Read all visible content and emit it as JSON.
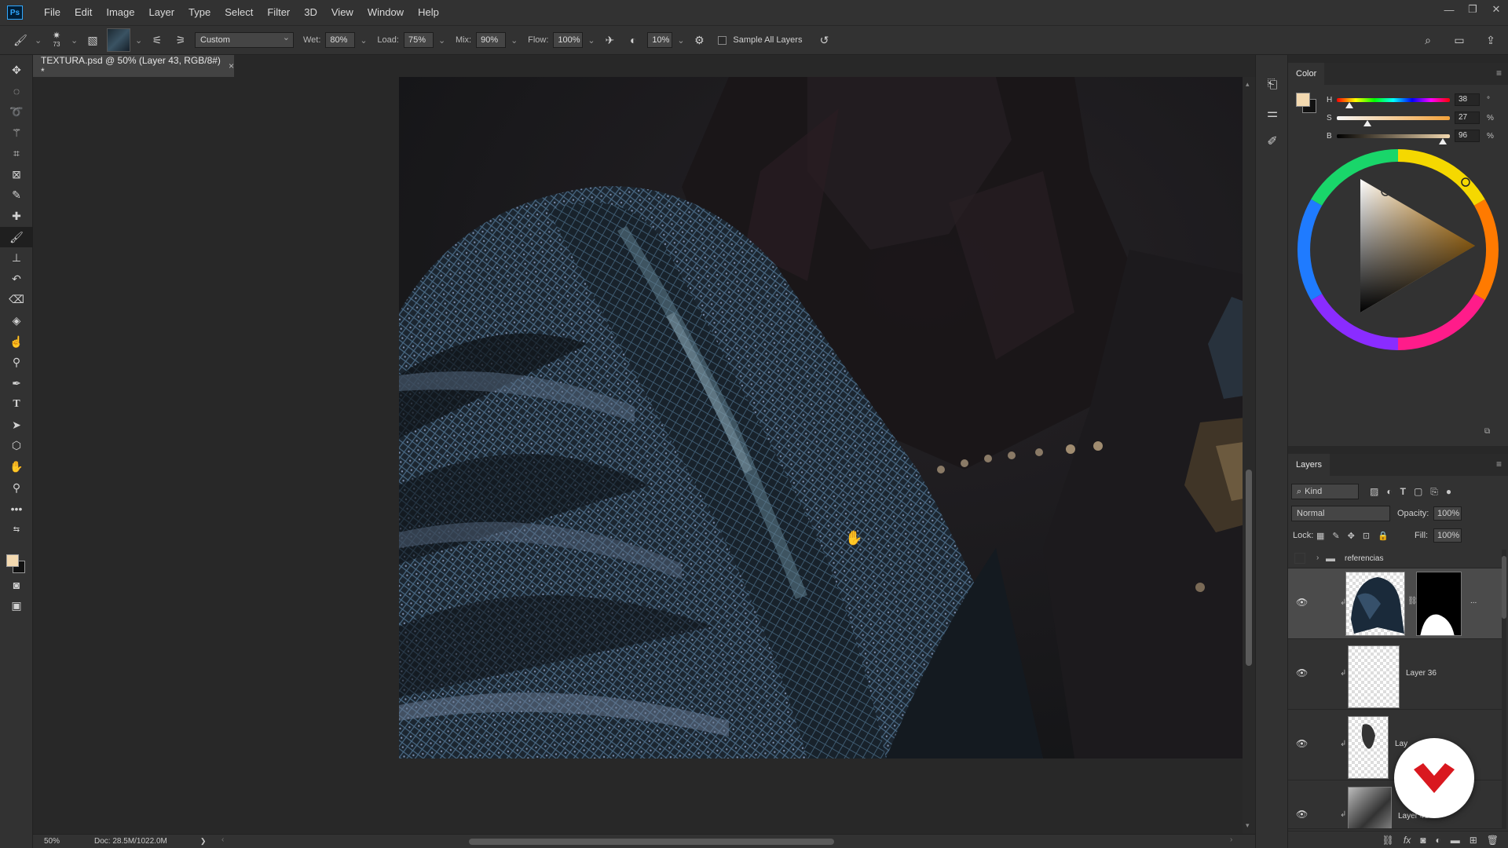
{
  "app": {
    "logo": "Ps"
  },
  "menu": [
    "File",
    "Edit",
    "Image",
    "Layer",
    "Type",
    "Select",
    "Filter",
    "3D",
    "View",
    "Window",
    "Help"
  ],
  "window_controls": [
    "minimize-icon",
    "restore-icon",
    "close-icon"
  ],
  "options_bar": {
    "brush_size": "73",
    "preset": "Custom",
    "wet_label": "Wet:",
    "wet": "80%",
    "load_label": "Load:",
    "load": "75%",
    "mix_label": "Mix:",
    "mix": "90%",
    "flow_label": "Flow:",
    "flow": "100%",
    "smoothing": "10%",
    "sample_all_layers": "Sample All Layers"
  },
  "document": {
    "tab_title": "TEXTURA.psd @ 50% (Layer 43, RGB/8#) *",
    "close": "×"
  },
  "status": {
    "zoom": "50%",
    "doc": "Doc: 28.5M/1022.0M",
    "arrow": "❯"
  },
  "colors": {
    "foreground": "#f3d9b0",
    "background": "#111111",
    "accent": "#31a8ff"
  },
  "color_panel": {
    "tab": "Color",
    "h_label": "H",
    "h": "38",
    "h_unit": "°",
    "s_label": "S",
    "s": "27",
    "s_unit": "%",
    "b_label": "B",
    "b": "96",
    "b_unit": "%"
  },
  "layers_panel": {
    "tab": "Layers",
    "filter": "Kind",
    "blend_mode": "Normal",
    "opacity_label": "Opacity:",
    "opacity": "100%",
    "lock_label": "Lock:",
    "fill_label": "Fill:",
    "fill": "100%",
    "group_name": "referencias",
    "layers": [
      {
        "name": "",
        "visible": true
      },
      {
        "name": "Layer 36",
        "visible": true
      },
      {
        "name": "Lay",
        "visible": true
      },
      {
        "name": "Layer 41",
        "visible": true
      }
    ],
    "more": "..."
  }
}
